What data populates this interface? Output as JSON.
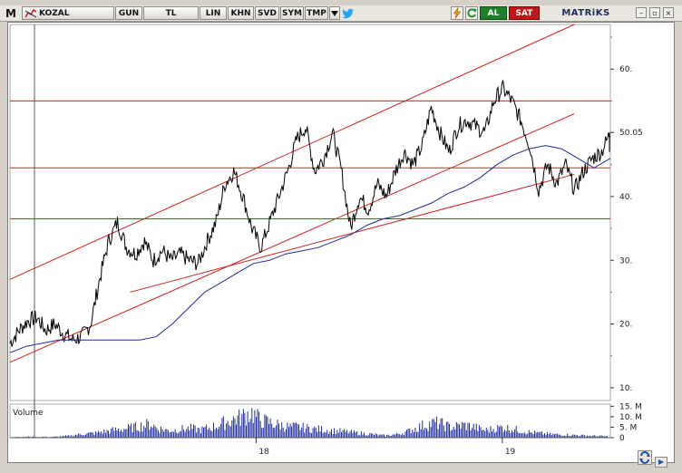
{
  "toolbar": {
    "logo": "M",
    "symbol": "KOZAL",
    "period": "GUN",
    "currency": "TL",
    "scale": "LIN",
    "buttons": [
      "KHN",
      "SVD",
      "SYM",
      "TMP"
    ],
    "buy_label": "AL",
    "sell_label": "SAT",
    "brand": "MATRiKS",
    "window_controls": [
      "–",
      "▫",
      "×"
    ]
  },
  "chart_data": [
    {
      "type": "line",
      "title": "",
      "x_ticks": [
        "18",
        "19"
      ],
      "y_ticks": [
        "10.",
        "20.",
        "30.",
        "40.",
        "50.05",
        "60."
      ],
      "ylim": [
        8,
        67
      ],
      "last_price": 50.05,
      "grid": false,
      "series": [
        {
          "values": [
            17,
            19,
            20.5,
            21,
            19,
            20,
            18.5,
            17.5,
            18,
            20,
            27,
            33,
            36,
            32,
            31,
            33,
            30,
            31.5,
            30,
            31,
            30,
            29.5,
            33,
            36,
            42,
            44,
            40,
            35,
            32,
            36,
            40,
            44,
            49,
            51,
            44,
            46,
            50,
            44,
            35,
            40,
            38,
            42,
            40,
            44,
            47,
            45,
            48,
            54,
            50,
            47,
            51,
            52,
            51,
            50,
            55,
            57,
            55,
            52,
            48,
            41,
            45,
            42,
            45,
            41,
            44,
            46,
            47,
            50
          ]
        },
        {
          "values": [
            15.5,
            16.5,
            17,
            17.5,
            17.5,
            17.5,
            17.5,
            17.5,
            17.5,
            18,
            20,
            22.5,
            25,
            26.5,
            28,
            29.5,
            30,
            31,
            31.5,
            32,
            33,
            34,
            35.5,
            36.5,
            37,
            38,
            39,
            40.5,
            41.5,
            43,
            45,
            46.5,
            47.5,
            48,
            47.5,
            46,
            44.5,
            46
          ]
        }
      ],
      "horizontal_levels": [
        55,
        44.5,
        36.5
      ],
      "trend_channel": {
        "upper": [
          [
            0,
            27
          ],
          [
            94,
            67
          ]
        ],
        "upper_mid": [
          [
            0,
            14
          ],
          [
            94,
            53
          ]
        ],
        "lower": [
          [
            20,
            25
          ],
          [
            94,
            43.5
          ]
        ]
      }
    },
    {
      "type": "bar",
      "title": "Volume",
      "y_ticks": [
        "15. M",
        "10. M",
        "5. M",
        "0"
      ],
      "ylim": [
        0,
        16
      ],
      "values": [
        0.3,
        0.4,
        0.3,
        0.5,
        0.4,
        0.3,
        0.4,
        0.3,
        0.5,
        0.6,
        0.8,
        1.2,
        1.5,
        1.8,
        2,
        2.2,
        2.8,
        3,
        3.5,
        3.8,
        4.2,
        4.5,
        5,
        5.5,
        6,
        6.5,
        4.5,
        4,
        3.5,
        3.5,
        4,
        4.2,
        4.5,
        4,
        3.8,
        4.5,
        5,
        6,
        7,
        8,
        9,
        9.5,
        11,
        12,
        9.5,
        8,
        7.5,
        6.5,
        6,
        5.5,
        5,
        5.2,
        4.8,
        4.5,
        4.2,
        4,
        3.8,
        3.5,
        3.2,
        3,
        2.8,
        2.5,
        2.2,
        2,
        1.8,
        1.5,
        1.2,
        1,
        1.3,
        1.6,
        2.2,
        3,
        4,
        5,
        6,
        6.5,
        7,
        6.5,
        5.5,
        5,
        5.5,
        6,
        5.5,
        5,
        4,
        3.5,
        4,
        4.5,
        5,
        4.5,
        4,
        3.5,
        3,
        2.5,
        2.2,
        2,
        1.8,
        1.6,
        1.5,
        1.4,
        1.3,
        1.2,
        1.1,
        1,
        0.9,
        0.8,
        0.7,
        0.6
      ]
    }
  ]
}
